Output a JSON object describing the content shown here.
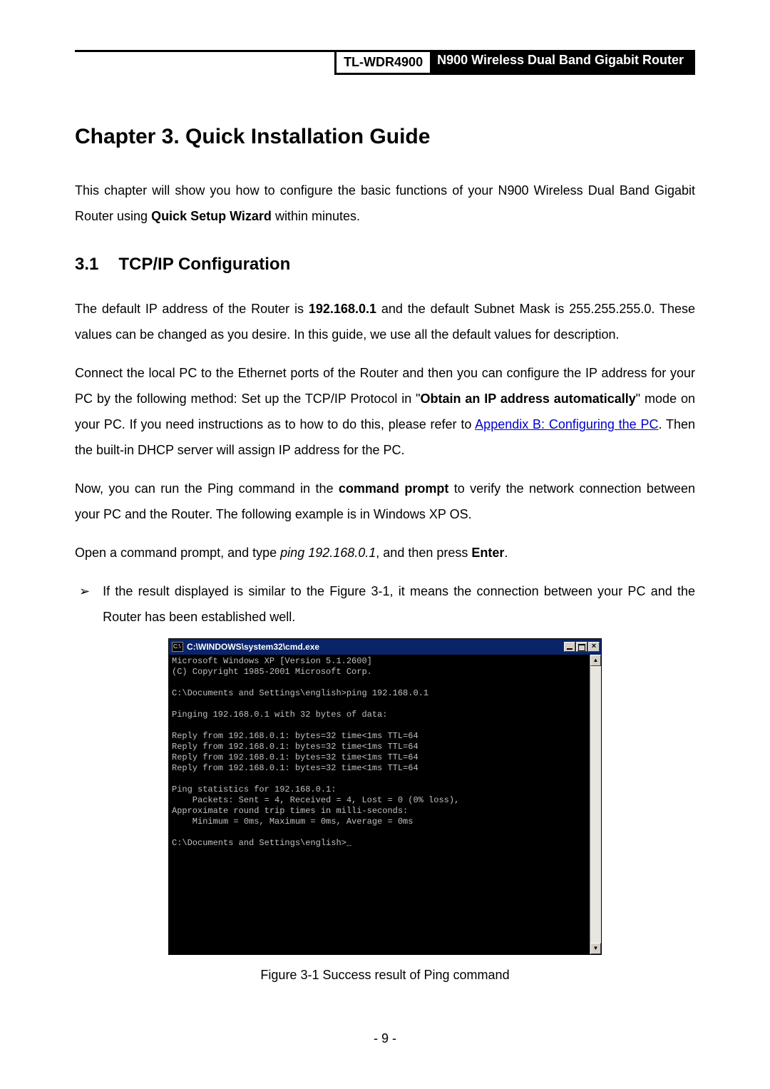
{
  "header": {
    "model": "TL-WDR4900",
    "product": "N900 Wireless Dual Band Gigabit Router"
  },
  "chapterTitle": "Chapter 3.   Quick Installation Guide",
  "intro": {
    "p1_a": "This  chapter  will  show  you  how  to  configure  the  basic  functions  of  your    N900  Wireless  Dual Band Gigabit Router using ",
    "p1_bold": "Quick Setup Wizard",
    "p1_b": " within minutes."
  },
  "section": {
    "num": "3.1",
    "title": "TCP/IP Configuration"
  },
  "p2": {
    "a": "The default IP address of the Router is ",
    "ip": "192.168.0.1",
    "b": " and the default Subnet Mask is 255.255.255.0. These  values  can  be  changed  as  you  desire.  In  this  guide,  we  use  all  the  default  values  for description."
  },
  "p3": {
    "a": "Connect  the  local  PC  to  the  Ethernet  ports  of  the  Router  and  then  you  can  configure  the  IP address  for  your  PC  by  the  following  method:  Set  up  the  TCP/IP  Protocol  in  \"",
    "b1": "Obtain  an  IP address automatically",
    "b": "\" mode on your PC. If you need instructions as to how to do this, please refer to ",
    "link": "Appendix B: Configuring the PC",
    "c": ". Then the built-in DHCP server will assign IP address for the PC."
  },
  "p4": {
    "a": "Now, you can run the Ping command in the ",
    "b1": "command prompt",
    "b": " to verify the network connection between your PC and the Router. The following example is in Windows XP OS."
  },
  "p5": {
    "a": "Open a command prompt, and type ",
    "i1": "ping 192.168.0.1",
    "b": ", and then press ",
    "b1": "Enter",
    "c": "."
  },
  "bullet": {
    "glyph": "➢",
    "text": "If the result displayed is similar to the Figure 3-1, it means the connection between your PC and the Router has been established well."
  },
  "cmd": {
    "title": "C:\\WINDOWS\\system32\\cmd.exe",
    "body": "Microsoft Windows XP [Version 5.1.2600]\n(C) Copyright 1985-2001 Microsoft Corp.\n\nC:\\Documents and Settings\\english>ping 192.168.0.1\n\nPinging 192.168.0.1 with 32 bytes of data:\n\nReply from 192.168.0.1: bytes=32 time<1ms TTL=64\nReply from 192.168.0.1: bytes=32 time<1ms TTL=64\nReply from 192.168.0.1: bytes=32 time<1ms TTL=64\nReply from 192.168.0.1: bytes=32 time<1ms TTL=64\n\nPing statistics for 192.168.0.1:\n    Packets: Sent = 4, Received = 4, Lost = 0 (0% loss),\nApproximate round trip times in milli-seconds:\n    Minimum = 0ms, Maximum = 0ms, Average = 0ms\n\nC:\\Documents and Settings\\english>_"
  },
  "figCaption": "Figure 3-1 Success result of Ping command",
  "pageNum": "- 9 -"
}
